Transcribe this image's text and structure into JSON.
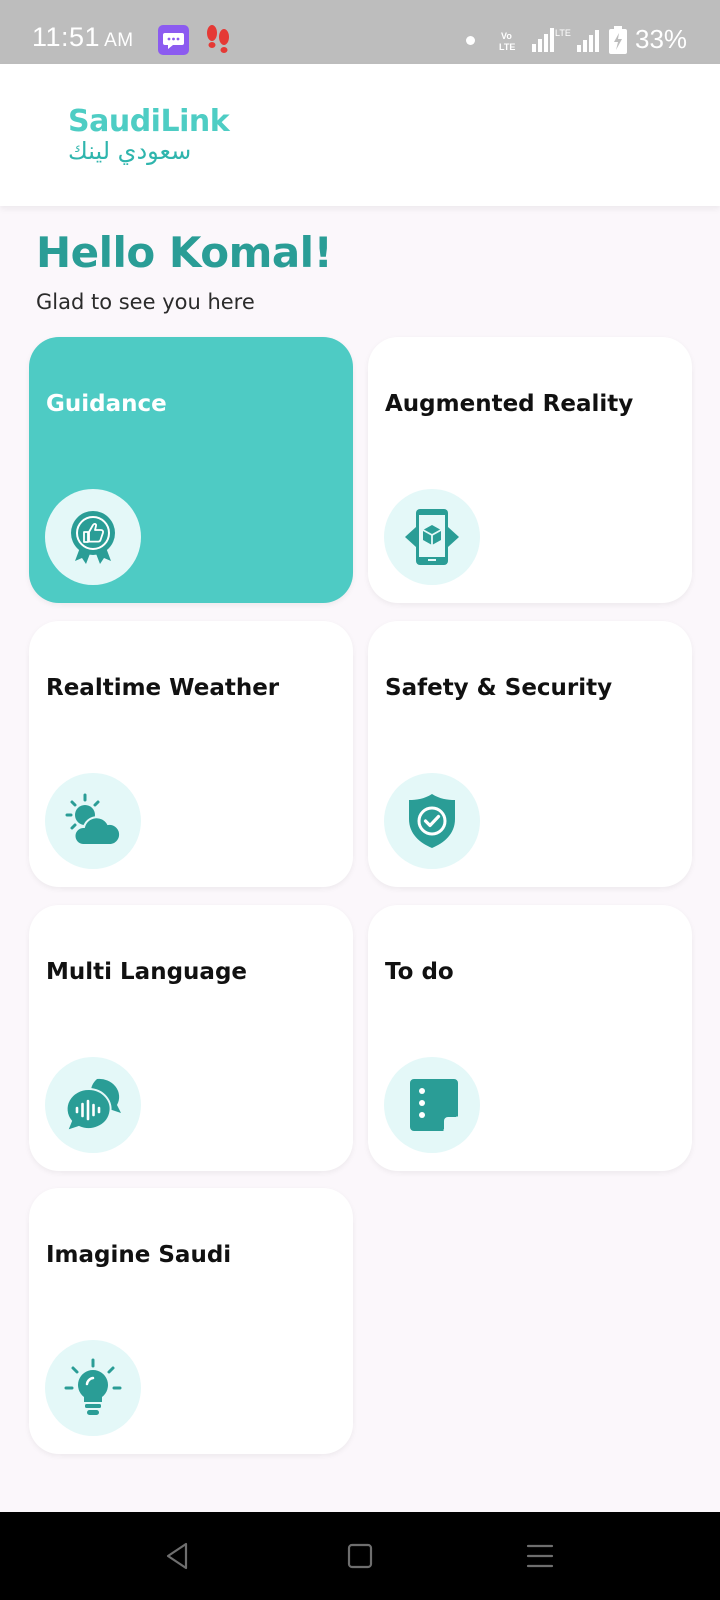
{
  "status_bar": {
    "time": "11:51",
    "ampm": "AM",
    "battery_text": "33%",
    "icons": [
      "message-icon",
      "footsteps-icon",
      "dot-icon",
      "volte-icon",
      "signal-lte-icon",
      "signal-icon",
      "battery-charging-icon"
    ]
  },
  "header": {
    "logo_en": "SaudiLink",
    "logo_ar": "سعودي لينك"
  },
  "greeting": {
    "title": "Hello Komal!",
    "subtitle": "Glad to see you here"
  },
  "cards": [
    {
      "label": "Guidance",
      "icon": "award-thumbs-up-icon",
      "active": true
    },
    {
      "label": "Augmented Reality",
      "icon": "ar-phone-cube-icon",
      "active": false
    },
    {
      "label": "Realtime Weather",
      "icon": "sun-cloud-icon",
      "active": false
    },
    {
      "label": "Safety & Security",
      "icon": "shield-check-icon",
      "active": false
    },
    {
      "label": "Multi Language",
      "icon": "chat-bubbles-icon",
      "active": false
    },
    {
      "label": "To do",
      "icon": "note-list-icon",
      "active": false
    },
    {
      "label": "Imagine Saudi",
      "icon": "lightbulb-icon",
      "active": false
    }
  ],
  "nav_bar": {
    "buttons": [
      "back-icon",
      "home-icon",
      "recents-icon"
    ]
  },
  "colors": {
    "accent": "#4ecbc4",
    "accent_dark": "#2a9d96",
    "icon_bg": "#e4f8f8",
    "status_bar": "#bdbdbd"
  }
}
